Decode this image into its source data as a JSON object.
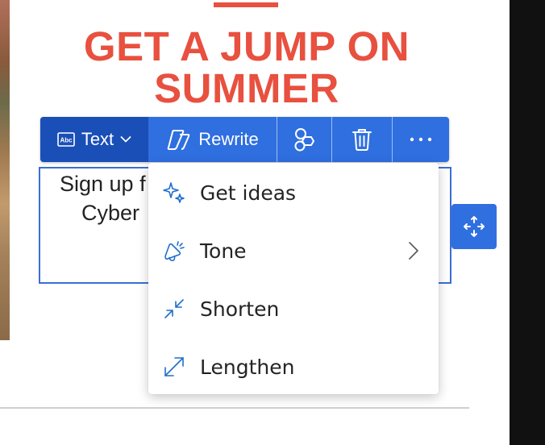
{
  "headline": {
    "line1": "GET A JUMP ON",
    "line2": "SUMMER"
  },
  "toolbar": {
    "text_label": "Text",
    "rewrite_label": "Rewrite"
  },
  "textbox": {
    "line1": "Sign up f",
    "line2": "Cyber"
  },
  "rewrite_menu": {
    "items": [
      {
        "label": "Get ideas",
        "icon": "sparkle-icon"
      },
      {
        "label": "Tone",
        "icon": "megaphone-icon",
        "has_submenu": true
      },
      {
        "label": "Shorten",
        "icon": "shrink-arrows-icon"
      },
      {
        "label": "Lengthen",
        "icon": "expand-arrow-icon"
      }
    ]
  },
  "colors": {
    "headline": "#e8503f",
    "toolbar": "#2f6fe0",
    "toolbar_active": "#1a4fb8",
    "menu_icon": "#1f6fc9"
  }
}
